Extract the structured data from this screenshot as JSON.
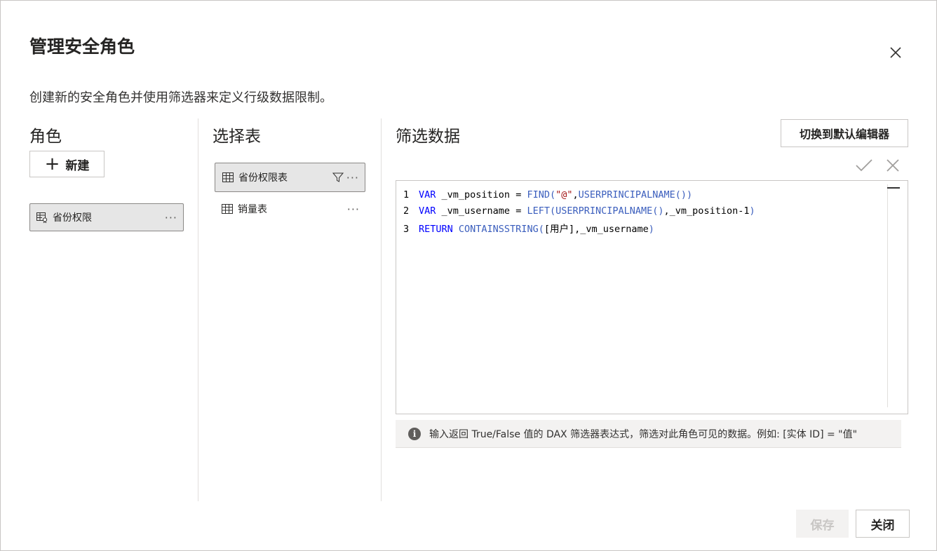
{
  "dialog": {
    "title": "管理安全角色",
    "subtitle": "创建新的安全角色并使用筛选器来定义行级数据限制。"
  },
  "roles": {
    "heading": "角色",
    "new_label": "新建",
    "items": [
      {
        "label": "省份权限",
        "more": "···"
      }
    ]
  },
  "tables": {
    "heading": "选择表",
    "items": [
      {
        "label": "省份权限表",
        "more": "···"
      },
      {
        "label": "销量表",
        "more": "···"
      }
    ]
  },
  "filter": {
    "heading": "筛选数据",
    "switch_label": "切换到默认编辑器",
    "code": [
      {
        "num": "1",
        "tokens": [
          [
            "kw",
            "VAR "
          ],
          [
            "plain",
            "_vm_position"
          ],
          [
            "plain",
            " = "
          ],
          [
            "fn",
            "FIND("
          ],
          [
            "str",
            "\"@\""
          ],
          [
            "plain",
            ","
          ],
          [
            "fn",
            "USERPRINCIPALNAME"
          ],
          [
            "fn",
            "())"
          ]
        ]
      },
      {
        "num": "2",
        "tokens": [
          [
            "kw",
            "VAR "
          ],
          [
            "plain",
            "_vm_username"
          ],
          [
            "plain",
            " = "
          ],
          [
            "fn",
            "LEFT("
          ],
          [
            "fn",
            "USERPRINCIPALNAME"
          ],
          [
            "fn",
            "()"
          ],
          [
            "plain",
            ","
          ],
          [
            "plain",
            "_vm_position"
          ],
          [
            "plain",
            "-1"
          ],
          [
            "fn",
            ")"
          ]
        ]
      },
      {
        "num": "3",
        "tokens": [
          [
            "kw",
            "RETURN "
          ],
          [
            "fn",
            "CONTAINSSTRING("
          ],
          [
            "plain",
            "[用户]"
          ],
          [
            "plain",
            ","
          ],
          [
            "plain",
            "_vm_username"
          ],
          [
            "fn",
            ")"
          ]
        ]
      }
    ],
    "info_text": "输入返回 True/False 值的 DAX 筛选器表达式，筛选对此角色可见的数据。例如: [实体 ID] = \"值\""
  },
  "footer": {
    "save_label": "保存",
    "close_label": "关闭"
  }
}
